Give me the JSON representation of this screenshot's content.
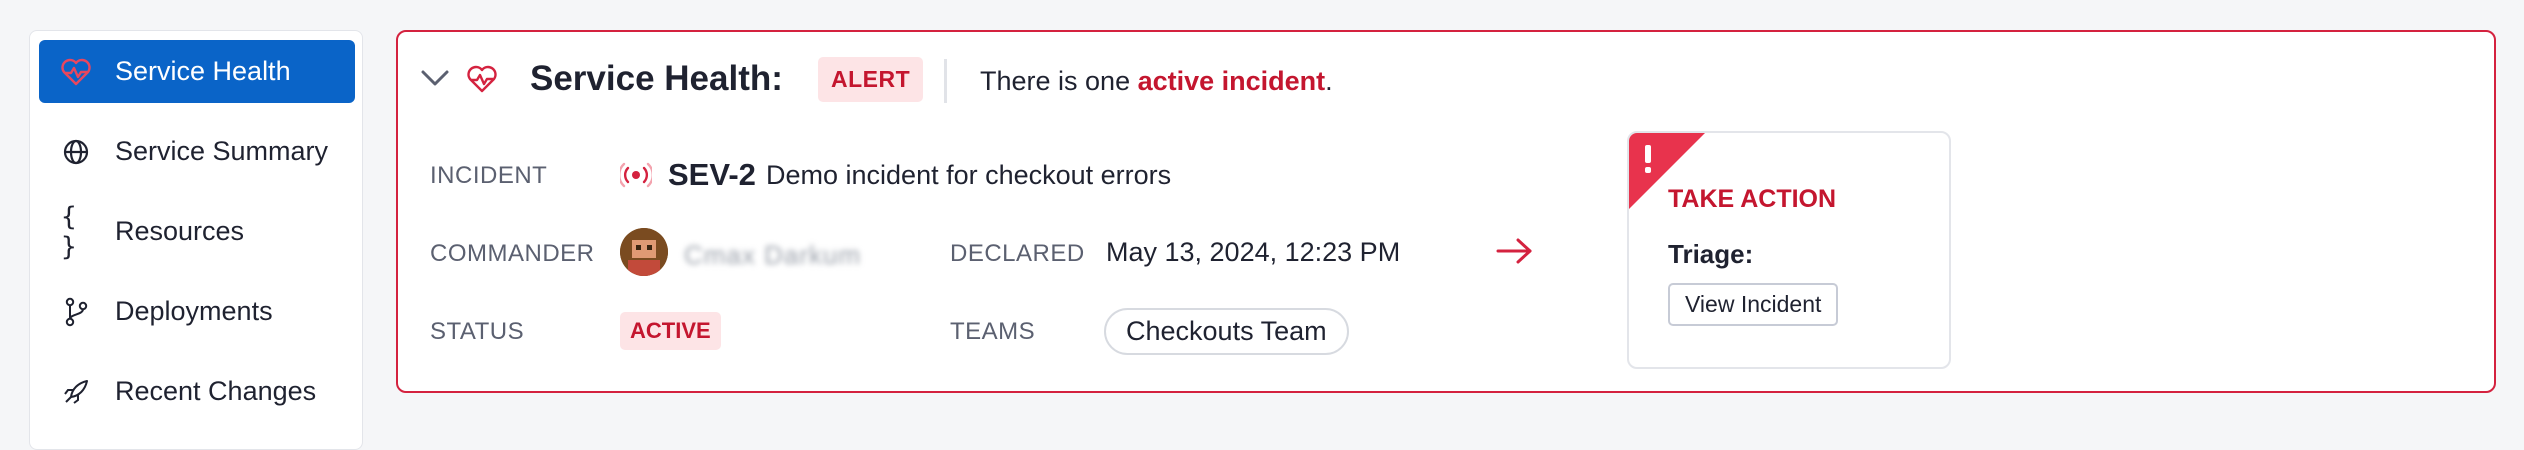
{
  "sidebar": {
    "items": [
      {
        "label": "Service Health",
        "icon": "heartbeat-icon",
        "active": true
      },
      {
        "label": "Service Summary",
        "icon": "globe-icon",
        "active": false
      },
      {
        "label": "Resources",
        "icon": "braces-icon",
        "active": false
      },
      {
        "label": "Deployments",
        "icon": "git-branch-icon",
        "active": false
      },
      {
        "label": "Recent Changes",
        "icon": "rocket-icon",
        "active": false
      }
    ]
  },
  "health": {
    "title": "Service Health:",
    "badge": "ALERT",
    "message_prefix": "There is one ",
    "message_link": "active incident",
    "message_suffix": ".",
    "incident_label": "INCIDENT",
    "severity": "SEV-2",
    "incident_title": "Demo incident for checkout errors",
    "commander_label": "COMMANDER",
    "commander_name": "Cmax Darkum",
    "declared_label": "DECLARED",
    "declared_value": "May 13, 2024, 12:23 PM",
    "status_label": "STATUS",
    "status_value": "ACTIVE",
    "teams_label": "TEAMS",
    "teams": [
      "Checkouts Team"
    ]
  },
  "action": {
    "title": "TAKE ACTION",
    "triage_label": "Triage:",
    "button_label": "View Incident"
  },
  "colors": {
    "accent": "#0a64c8",
    "alert": "#d4223f",
    "alert_text": "#c4162f",
    "alert_bg": "#fde4e6"
  }
}
